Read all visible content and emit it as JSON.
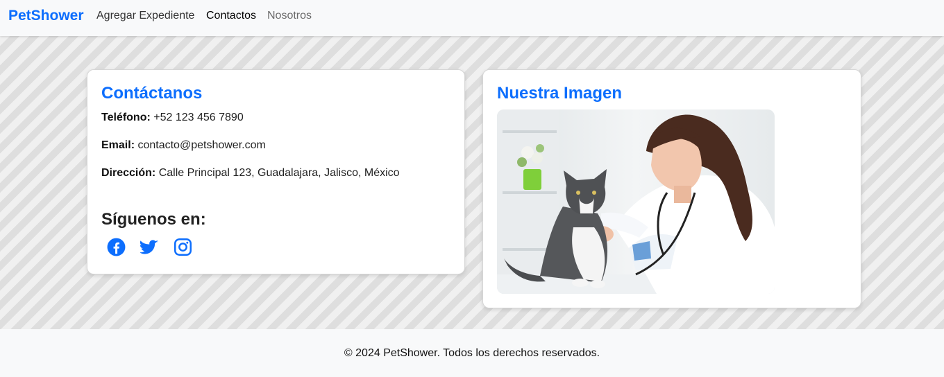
{
  "navbar": {
    "brand": "PetShower",
    "links": [
      {
        "label": "Agregar Expediente"
      },
      {
        "label": "Contactos"
      },
      {
        "label": "Nosotros"
      }
    ]
  },
  "contact": {
    "title": "Contáctanos",
    "phone_label": "Teléfono:",
    "phone_value": "+52 123 456 7890",
    "email_label": "Email:",
    "email_value": "contacto@petshower.com",
    "address_label": "Dirección:",
    "address_value": "Calle Principal 123, Guadalajara, Jalisco, México",
    "follow_title": "Síguenos en:",
    "socials": [
      {
        "icon": "facebook-icon"
      },
      {
        "icon": "twitter-icon"
      },
      {
        "icon": "instagram-icon"
      }
    ]
  },
  "image_card": {
    "title": "Nuestra Imagen",
    "photo_icon": "veterinarian-with-cat-photo"
  },
  "footer": {
    "text": "© 2024 PetShower. Todos los derechos reservados."
  },
  "colors": {
    "accent": "#0d6efd",
    "navbar_bg": "#f8f9fa",
    "stripe_light": "#f0f0f0",
    "stripe_dark": "#dedede"
  }
}
